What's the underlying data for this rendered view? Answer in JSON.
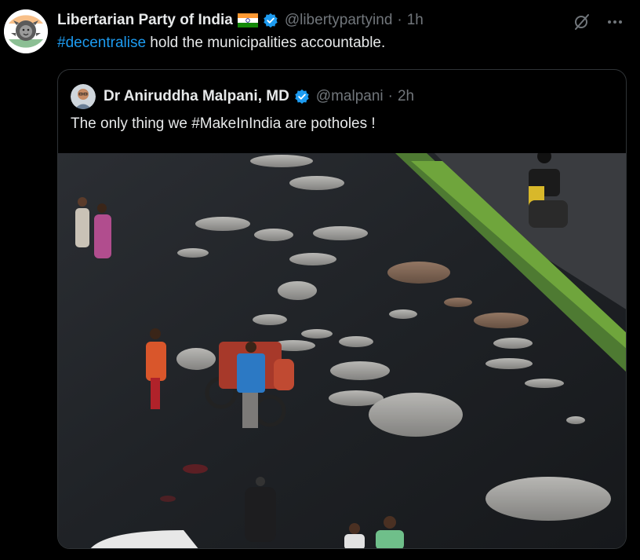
{
  "tweet": {
    "author": {
      "name": "Libertarian Party of India",
      "handle": "@libertypartyind",
      "time": "1h",
      "flag_icon": "india-flag-icon",
      "verified_icon": "verified-badge-icon",
      "avatar_icon": "lion-logo-icon"
    },
    "text": {
      "hashtag": "#decentralise",
      "body": " hold the municipalities accountable."
    },
    "actions": {
      "grok_icon": "grok-icon",
      "more_icon": "more-options-icon"
    }
  },
  "quote": {
    "author": {
      "name": "Dr Aniruddha Malpani, MD",
      "handle": "@malpani",
      "time": "2h"
    },
    "text": "The only thing we #MakeInIndia are potholes !",
    "media_icon": "pothole-road-photo"
  },
  "separator": "·",
  "colors": {
    "background": "#000000",
    "text": "#e7e9ea",
    "muted": "#71767b",
    "link": "#1d9bf0",
    "border": "#2f3336",
    "verified": "#1d9bf0"
  }
}
